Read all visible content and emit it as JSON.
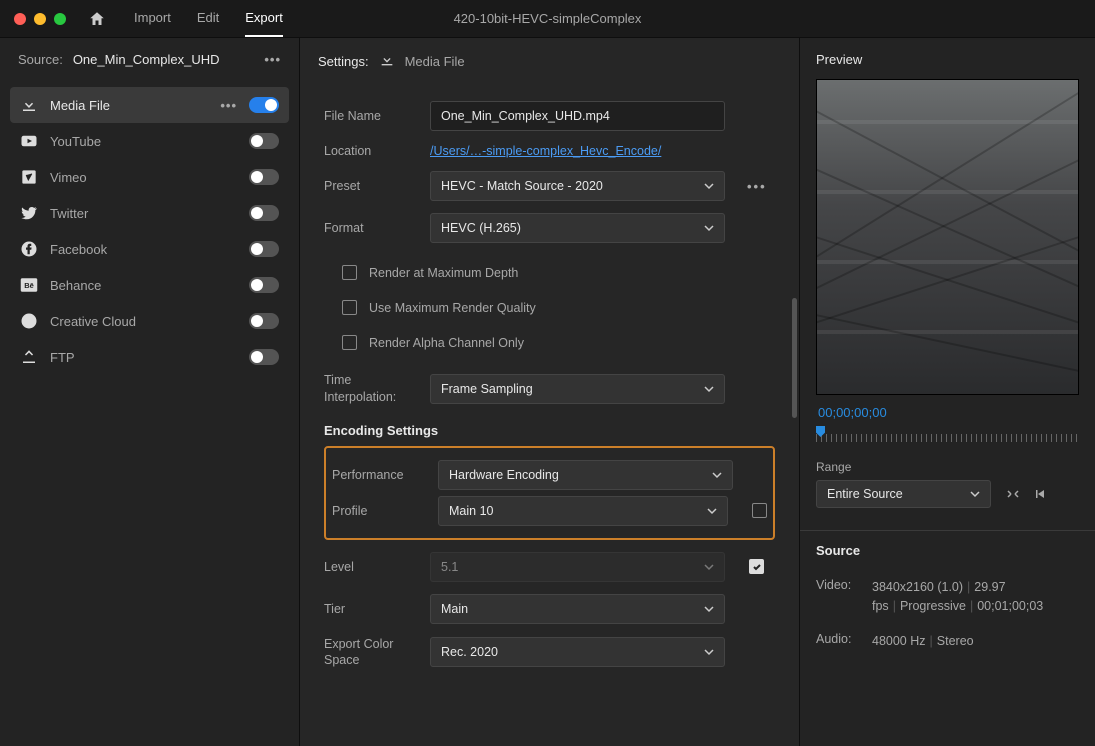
{
  "window_title": "420-10bit-HEVC-simpleComplex",
  "tabs": {
    "import": "Import",
    "edit": "Edit",
    "export": "Export"
  },
  "source": {
    "label": "Source:",
    "name": "One_Min_Complex_UHD"
  },
  "destinations": [
    {
      "label": "Media File",
      "active": true,
      "on": true
    },
    {
      "label": "YouTube",
      "active": false,
      "on": false
    },
    {
      "label": "Vimeo",
      "active": false,
      "on": false
    },
    {
      "label": "Twitter",
      "active": false,
      "on": false
    },
    {
      "label": "Facebook",
      "active": false,
      "on": false
    },
    {
      "label": "Behance",
      "active": false,
      "on": false
    },
    {
      "label": "Creative Cloud",
      "active": false,
      "on": false
    },
    {
      "label": "FTP",
      "active": false,
      "on": false
    }
  ],
  "settings": {
    "title": "Settings:",
    "subtitle": "Media File",
    "file_name_label": "File Name",
    "file_name": "One_Min_Complex_UHD.mp4",
    "location_label": "Location",
    "location": "/Users/…-simple-complex_Hevc_Encode/",
    "preset_label": "Preset",
    "preset": "HEVC - Match Source - 2020",
    "format_label": "Format",
    "format": "HEVC (H.265)",
    "check_max_depth": "Render at Maximum Depth",
    "check_max_quality": "Use Maximum Render Quality",
    "check_alpha": "Render Alpha Channel Only",
    "time_interp_label": "Time Interpolation:",
    "time_interp": "Frame Sampling",
    "encoding_title": "Encoding Settings",
    "performance_label": "Performance",
    "performance": "Hardware Encoding",
    "profile_label": "Profile",
    "profile": "Main 10",
    "level_label": "Level",
    "level": "5.1",
    "tier_label": "Tier",
    "tier": "Main",
    "colorspace_label": "Export Color Space",
    "colorspace": "Rec. 2020"
  },
  "preview": {
    "title": "Preview",
    "timecode": "00;00;00;00",
    "range_label": "Range",
    "range": "Entire Source",
    "source_title": "Source",
    "video_label": "Video:",
    "video_meta": "3840x2160 (1.0) | 29.97 fps | Progressive | 00;01;00;03",
    "audio_label": "Audio:",
    "audio_meta": "48000 Hz | Stereo"
  }
}
